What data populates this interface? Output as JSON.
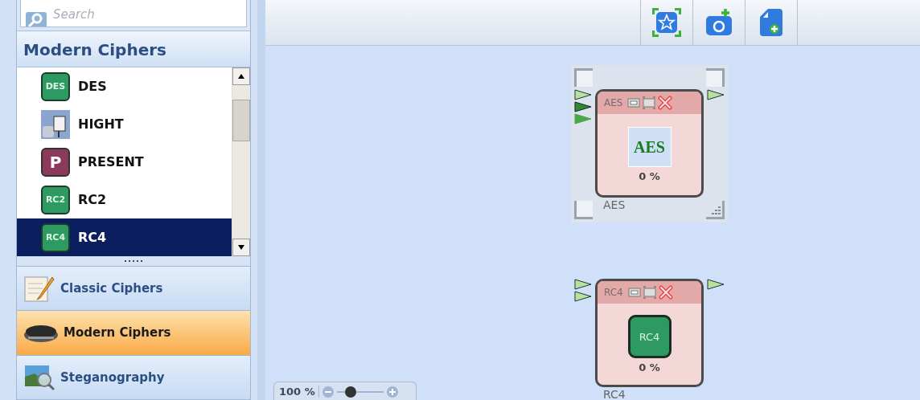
{
  "search": {
    "placeholder": "Search"
  },
  "list_header": "Modern Ciphers",
  "components": [
    {
      "name": "DES",
      "selected": false,
      "icon": {
        "kind": "badge",
        "text": "DES",
        "color": "#2e9a62"
      }
    },
    {
      "name": "HIGHT",
      "selected": false
    },
    {
      "name": "PRESENT",
      "selected": false,
      "icon": {
        "kind": "letter",
        "text": "P",
        "color": "#8c3a5c"
      }
    },
    {
      "name": "RC2",
      "selected": false,
      "icon": {
        "kind": "badge",
        "text": "RC2",
        "color": "#2e9a62"
      }
    },
    {
      "name": "RC4",
      "selected": true,
      "icon": {
        "kind": "badge",
        "text": "RC4",
        "color": "#2e9a62"
      }
    }
  ],
  "categories": [
    {
      "label": "Classic Ciphers",
      "kind": "notepad",
      "selected": false
    },
    {
      "label": "Modern Ciphers",
      "kind": "chip",
      "selected": true
    },
    {
      "label": "Steganography",
      "kind": "landscape",
      "selected": false
    }
  ],
  "modules": [
    {
      "title": "AES",
      "caption": "AES",
      "progress": "0 %",
      "selected": true,
      "icon": {
        "kind": "text",
        "text": "AES"
      },
      "inputs": [
        {
          "kind": "open"
        },
        {
          "kind": "dark"
        },
        {
          "kind": "filled"
        }
      ],
      "outputs": [
        {
          "kind": "open"
        }
      ]
    },
    {
      "title": "RC4",
      "caption": "RC4",
      "progress": "0 %",
      "selected": false,
      "icon": {
        "kind": "badge",
        "text": "RC4"
      },
      "inputs": [
        {
          "kind": "open"
        },
        {
          "kind": "open"
        }
      ],
      "outputs": [
        {
          "kind": "open"
        }
      ]
    }
  ],
  "zoom": {
    "label": "100 %",
    "level": 0.3
  }
}
